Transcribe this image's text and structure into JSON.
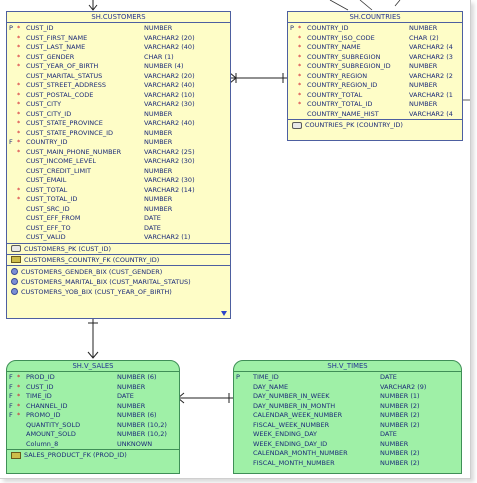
{
  "customers": {
    "title": "SH.CUSTOMERS",
    "columns": [
      {
        "key": "P",
        "mand": "*",
        "name": "CUST_ID",
        "type": "NUMBER"
      },
      {
        "key": "",
        "mand": "*",
        "name": "CUST_FIRST_NAME",
        "type": "VARCHAR2 (20)"
      },
      {
        "key": "",
        "mand": "*",
        "name": "CUST_LAST_NAME",
        "type": "VARCHAR2 (40)"
      },
      {
        "key": "",
        "mand": "*",
        "name": "CUST_GENDER",
        "type": "CHAR (1)"
      },
      {
        "key": "",
        "mand": "*",
        "name": "CUST_YEAR_OF_BIRTH",
        "type": "NUMBER (4)"
      },
      {
        "key": "",
        "mand": "",
        "name": "CUST_MARITAL_STATUS",
        "type": "VARCHAR2 (20)"
      },
      {
        "key": "",
        "mand": "*",
        "name": "CUST_STREET_ADDRESS",
        "type": "VARCHAR2 (40)"
      },
      {
        "key": "",
        "mand": "*",
        "name": "CUST_POSTAL_CODE",
        "type": "VARCHAR2 (10)"
      },
      {
        "key": "",
        "mand": "*",
        "name": "CUST_CITY",
        "type": "VARCHAR2 (30)"
      },
      {
        "key": "",
        "mand": "*",
        "name": "CUST_CITY_ID",
        "type": "NUMBER"
      },
      {
        "key": "",
        "mand": "*",
        "name": "CUST_STATE_PROVINCE",
        "type": "VARCHAR2 (40)"
      },
      {
        "key": "",
        "mand": "*",
        "name": "CUST_STATE_PROVINCE_ID",
        "type": "NUMBER"
      },
      {
        "key": "F",
        "mand": "*",
        "name": "COUNTRY_ID",
        "type": "NUMBER"
      },
      {
        "key": "",
        "mand": "*",
        "name": "CUST_MAIN_PHONE_NUMBER",
        "type": "VARCHAR2 (25)"
      },
      {
        "key": "",
        "mand": "",
        "name": "CUST_INCOME_LEVEL",
        "type": "VARCHAR2 (30)"
      },
      {
        "key": "",
        "mand": "",
        "name": "CUST_CREDIT_LIMIT",
        "type": "NUMBER"
      },
      {
        "key": "",
        "mand": "",
        "name": "CUST_EMAIL",
        "type": "VARCHAR2 (30)"
      },
      {
        "key": "",
        "mand": "*",
        "name": "CUST_TOTAL",
        "type": "VARCHAR2 (14)"
      },
      {
        "key": "",
        "mand": "*",
        "name": "CUST_TOTAL_ID",
        "type": "NUMBER"
      },
      {
        "key": "",
        "mand": "",
        "name": "CUST_SRC_ID",
        "type": "NUMBER"
      },
      {
        "key": "",
        "mand": "",
        "name": "CUST_EFF_FROM",
        "type": "DATE"
      },
      {
        "key": "",
        "mand": "",
        "name": "CUST_EFF_TO",
        "type": "DATE"
      },
      {
        "key": "",
        "mand": "",
        "name": "CUST_VALID",
        "type": "VARCHAR2 (1)"
      }
    ],
    "pk": "CUSTOMERS_PK (CUST_ID)",
    "fk": "CUSTOMERS_COUNTRY_FK (COUNTRY_ID)",
    "indexes": [
      "CUSTOMERS_GENDER_BIX (CUST_GENDER)",
      "CUSTOMERS_MARITAL_BIX (CUST_MARITAL_STATUS)",
      "CUSTOMERS_YOB_BIX (CUST_YEAR_OF_BIRTH)"
    ]
  },
  "countries": {
    "title": "SH.COUNTRIES",
    "columns": [
      {
        "key": "P",
        "mand": "*",
        "name": "COUNTRY_ID",
        "type": "NUMBER"
      },
      {
        "key": "",
        "mand": "*",
        "name": "COUNTRY_ISO_CODE",
        "type": "CHAR (2)"
      },
      {
        "key": "",
        "mand": "*",
        "name": "COUNTRY_NAME",
        "type": "VARCHAR2 (4"
      },
      {
        "key": "",
        "mand": "*",
        "name": "COUNTRY_SUBREGION",
        "type": "VARCHAR2 (3"
      },
      {
        "key": "",
        "mand": "*",
        "name": "COUNTRY_SUBREGION_ID",
        "type": "NUMBER"
      },
      {
        "key": "",
        "mand": "*",
        "name": "COUNTRY_REGION",
        "type": "VARCHAR2 (2"
      },
      {
        "key": "",
        "mand": "*",
        "name": "COUNTRY_REGION_ID",
        "type": "NUMBER"
      },
      {
        "key": "",
        "mand": "*",
        "name": "COUNTRY_TOTAL",
        "type": "VARCHAR2 (1"
      },
      {
        "key": "",
        "mand": "*",
        "name": "COUNTRY_TOTAL_ID",
        "type": "NUMBER"
      },
      {
        "key": "",
        "mand": "",
        "name": "COUNTRY_NAME_HIST",
        "type": "VARCHAR2 (4"
      }
    ],
    "pk": "COUNTRIES_PK (COUNTRY_ID)"
  },
  "sales": {
    "title": "SH.V_SALES",
    "columns": [
      {
        "key": "F",
        "mand": "*",
        "name": "PROD_ID",
        "type": "NUMBER (6)"
      },
      {
        "key": "F",
        "mand": "*",
        "name": "CUST_ID",
        "type": "NUMBER"
      },
      {
        "key": "F",
        "mand": "*",
        "name": "TIME_ID",
        "type": "DATE"
      },
      {
        "key": "F",
        "mand": "*",
        "name": "CHANNEL_ID",
        "type": "NUMBER"
      },
      {
        "key": "F",
        "mand": "*",
        "name": "PROMO_ID",
        "type": "NUMBER (6)"
      },
      {
        "key": "",
        "mand": "",
        "name": "QUANTITY_SOLD",
        "type": "NUMBER (10,2)"
      },
      {
        "key": "",
        "mand": "",
        "name": "AMOUNT_SOLD",
        "type": "NUMBER (10,2)"
      },
      {
        "key": "",
        "mand": "",
        "name": "Column_8",
        "type": "UNKNOWN"
      }
    ],
    "fk": "SALES_PRODUCT_FK (PROD_ID)"
  },
  "times": {
    "title": "SH.V_TIMES",
    "columns": [
      {
        "key": "P",
        "mand": "",
        "name": "TIME_ID",
        "type": "DATE"
      },
      {
        "key": "",
        "mand": "",
        "name": "DAY_NAME",
        "type": "VARCHAR2 (9)"
      },
      {
        "key": "",
        "mand": "",
        "name": "DAY_NUMBER_IN_WEEK",
        "type": "NUMBER (1)"
      },
      {
        "key": "",
        "mand": "",
        "name": "DAY_NUMBER_IN_MONTH",
        "type": "NUMBER (2)"
      },
      {
        "key": "",
        "mand": "",
        "name": "CALENDAR_WEEK_NUMBER",
        "type": "NUMBER (2)"
      },
      {
        "key": "",
        "mand": "",
        "name": "FISCAL_WEEK_NUMBER",
        "type": "NUMBER (2)"
      },
      {
        "key": "",
        "mand": "",
        "name": "WEEK_ENDING_DAY",
        "type": "DATE"
      },
      {
        "key": "",
        "mand": "",
        "name": "WEEK_ENDING_DAY_ID",
        "type": "NUMBER"
      },
      {
        "key": "",
        "mand": "",
        "name": "CALENDAR_MONTH_NUMBER",
        "type": "NUMBER (2)"
      },
      {
        "key": "",
        "mand": "",
        "name": "FISCAL_MONTH_NUMBER",
        "type": "NUMBER (2)"
      }
    ]
  }
}
